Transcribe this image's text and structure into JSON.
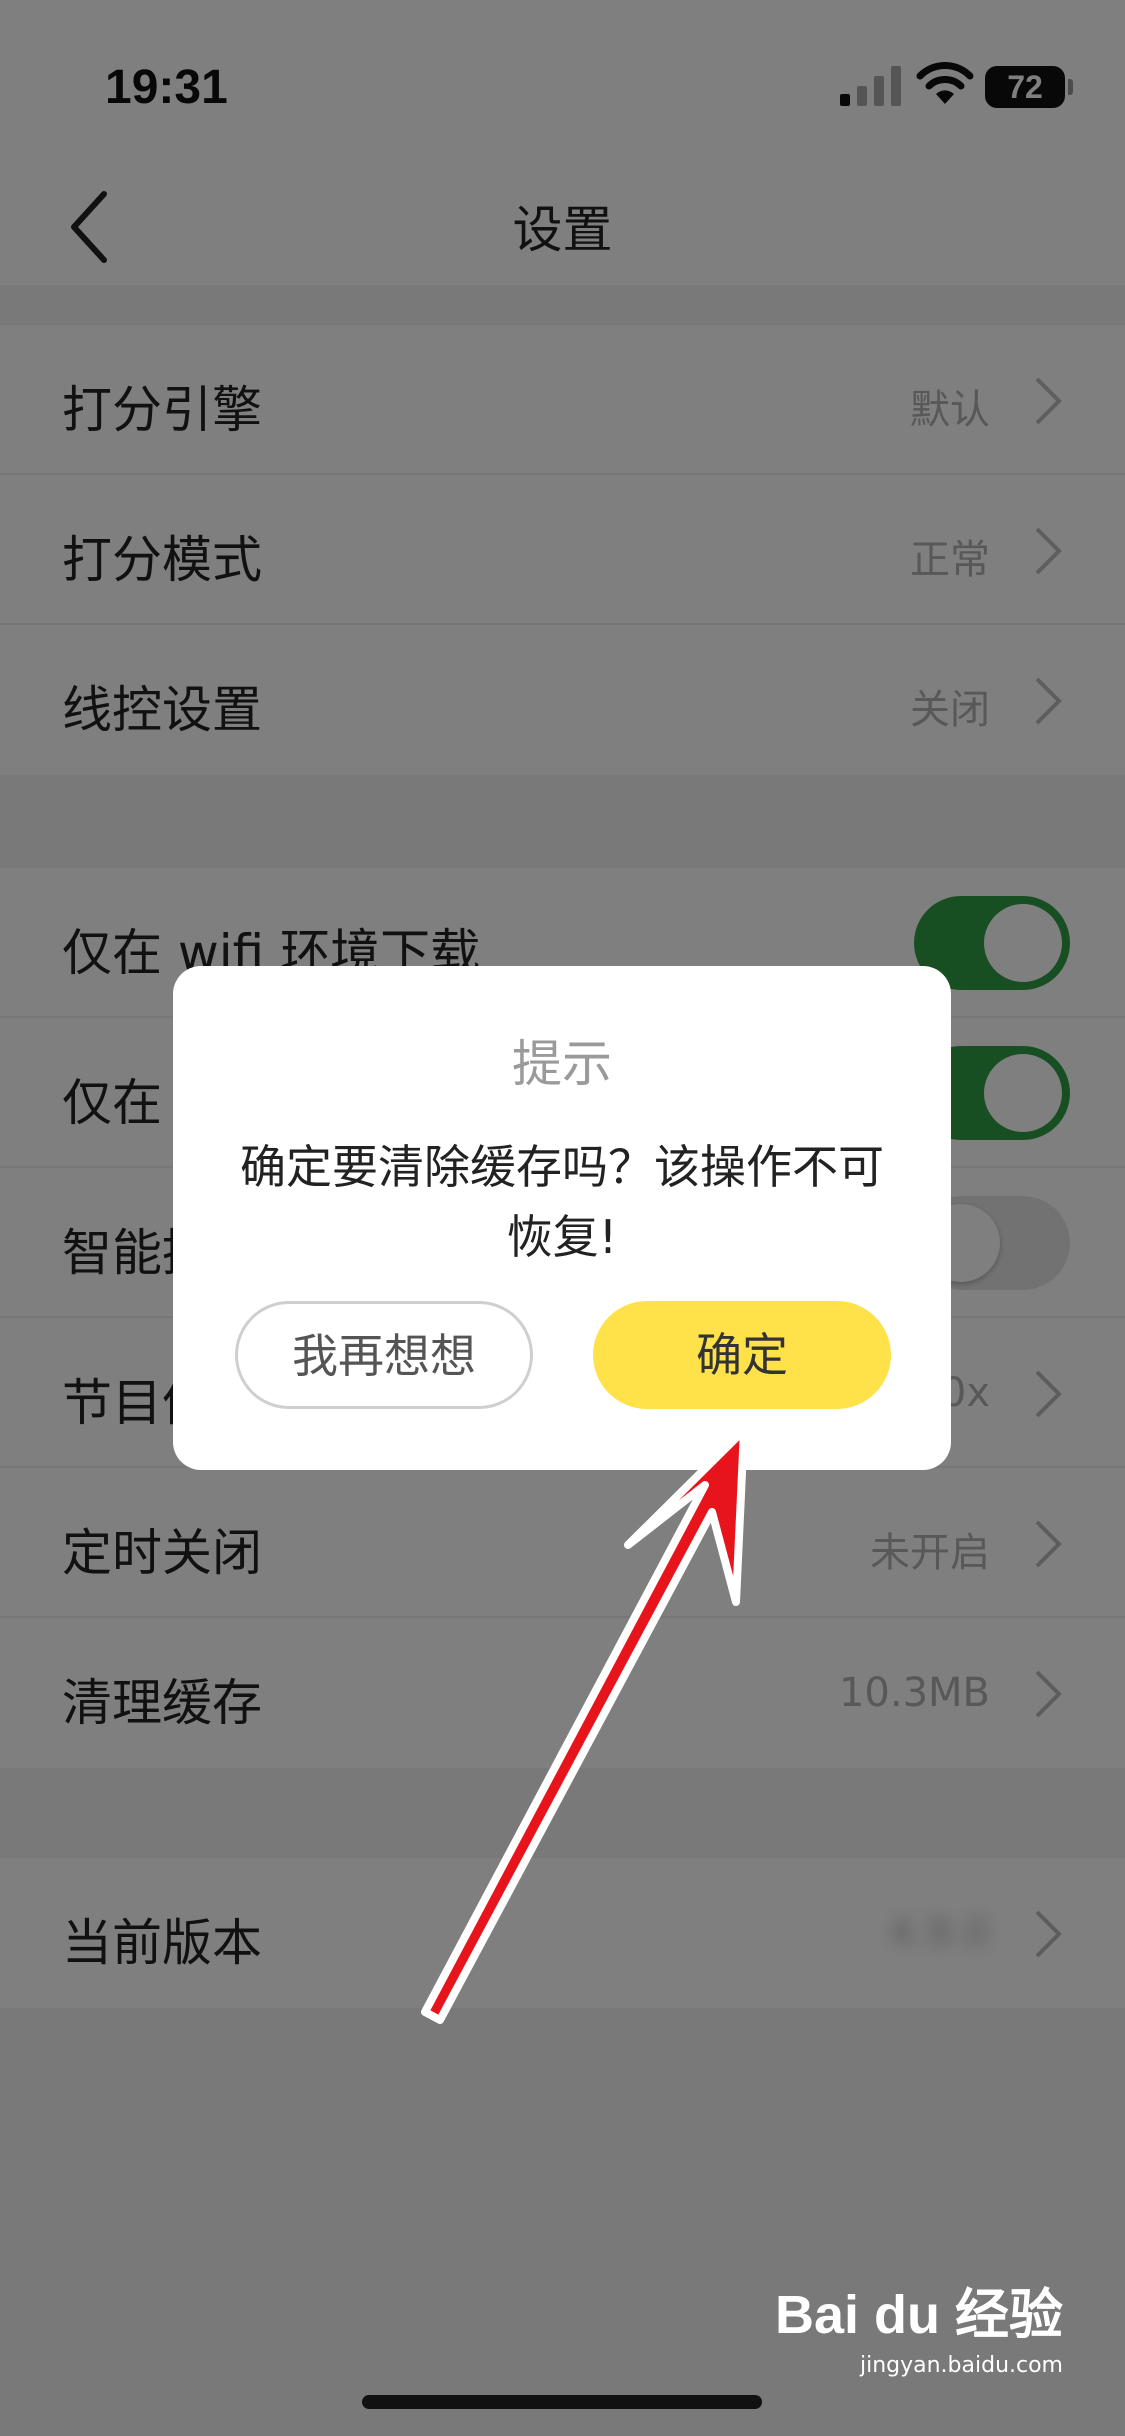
{
  "status_bar": {
    "time": "19:31",
    "battery": "72"
  },
  "nav": {
    "title": "设置"
  },
  "group1": [
    {
      "label": "打分引擎",
      "value": "默认"
    },
    {
      "label": "打分模式",
      "value": "正常"
    },
    {
      "label": "线控设置",
      "value": "关闭"
    }
  ],
  "group2": [
    {
      "label": "仅在 wifi 环境下载",
      "toggle": "on"
    },
    {
      "label": "仅在",
      "toggle": "on"
    },
    {
      "label": "智能推",
      "toggle": "off"
    },
    {
      "label": "节目倍",
      "value": "0x"
    },
    {
      "label": "定时关闭",
      "value": "未开启"
    },
    {
      "label": "清理缓存",
      "value": "10.3MB"
    }
  ],
  "group3": [
    {
      "label": "当前版本",
      "value": "4.9.0"
    }
  ],
  "dialog": {
    "title": "提示",
    "message": "确定要清除缓存吗？该操作不可恢复!",
    "cancel_label": "我再想想",
    "confirm_label": "确定"
  },
  "watermark": {
    "logo": "Bai du 经验",
    "url": "jingyan.baidu.com"
  },
  "colors": {
    "toggle_on": "#2f9e44",
    "confirm_button": "#ffe24a",
    "annotation_arrow": "#e8141c"
  }
}
